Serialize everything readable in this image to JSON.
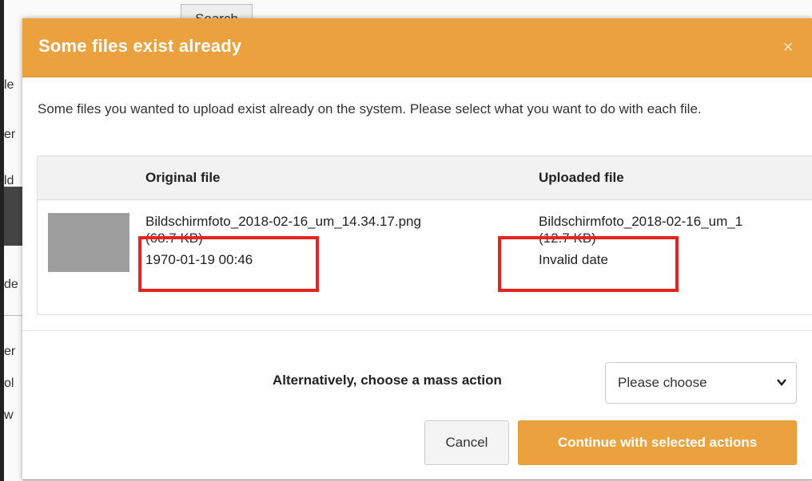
{
  "background": {
    "search_label": "Search",
    "fragments": [
      "le",
      "er",
      "ld",
      "de",
      "er",
      "ol",
      "w"
    ]
  },
  "modal": {
    "title": "Some files exist already",
    "close_glyph": "×",
    "intro": "Some files you wanted to upload exist already on the system. Please select what you want to do with each file."
  },
  "table": {
    "headers": {
      "original": "Original file",
      "uploaded": "Uploaded file"
    },
    "row": {
      "original": {
        "name": "Bildschirmfoto_2018-02-16_um_14.34.17.png",
        "size": "(68.7 KB)",
        "date": "1970-01-19 00:46"
      },
      "uploaded": {
        "name": "Bildschirmfoto_2018-02-16_um_1",
        "size": "(12.7 KB)",
        "date": "Invalid date"
      }
    }
  },
  "mass_action": {
    "label": "Alternatively, choose a mass action",
    "selected": "Please choose"
  },
  "buttons": {
    "cancel": "Cancel",
    "continue": "Continue with selected actions"
  },
  "colors": {
    "header": "#eba23e",
    "highlight": "#e8231f",
    "primary_button": "#eba23e"
  },
  "icons": {
    "dropdown": "chevron-down-icon",
    "close": "close-icon"
  }
}
